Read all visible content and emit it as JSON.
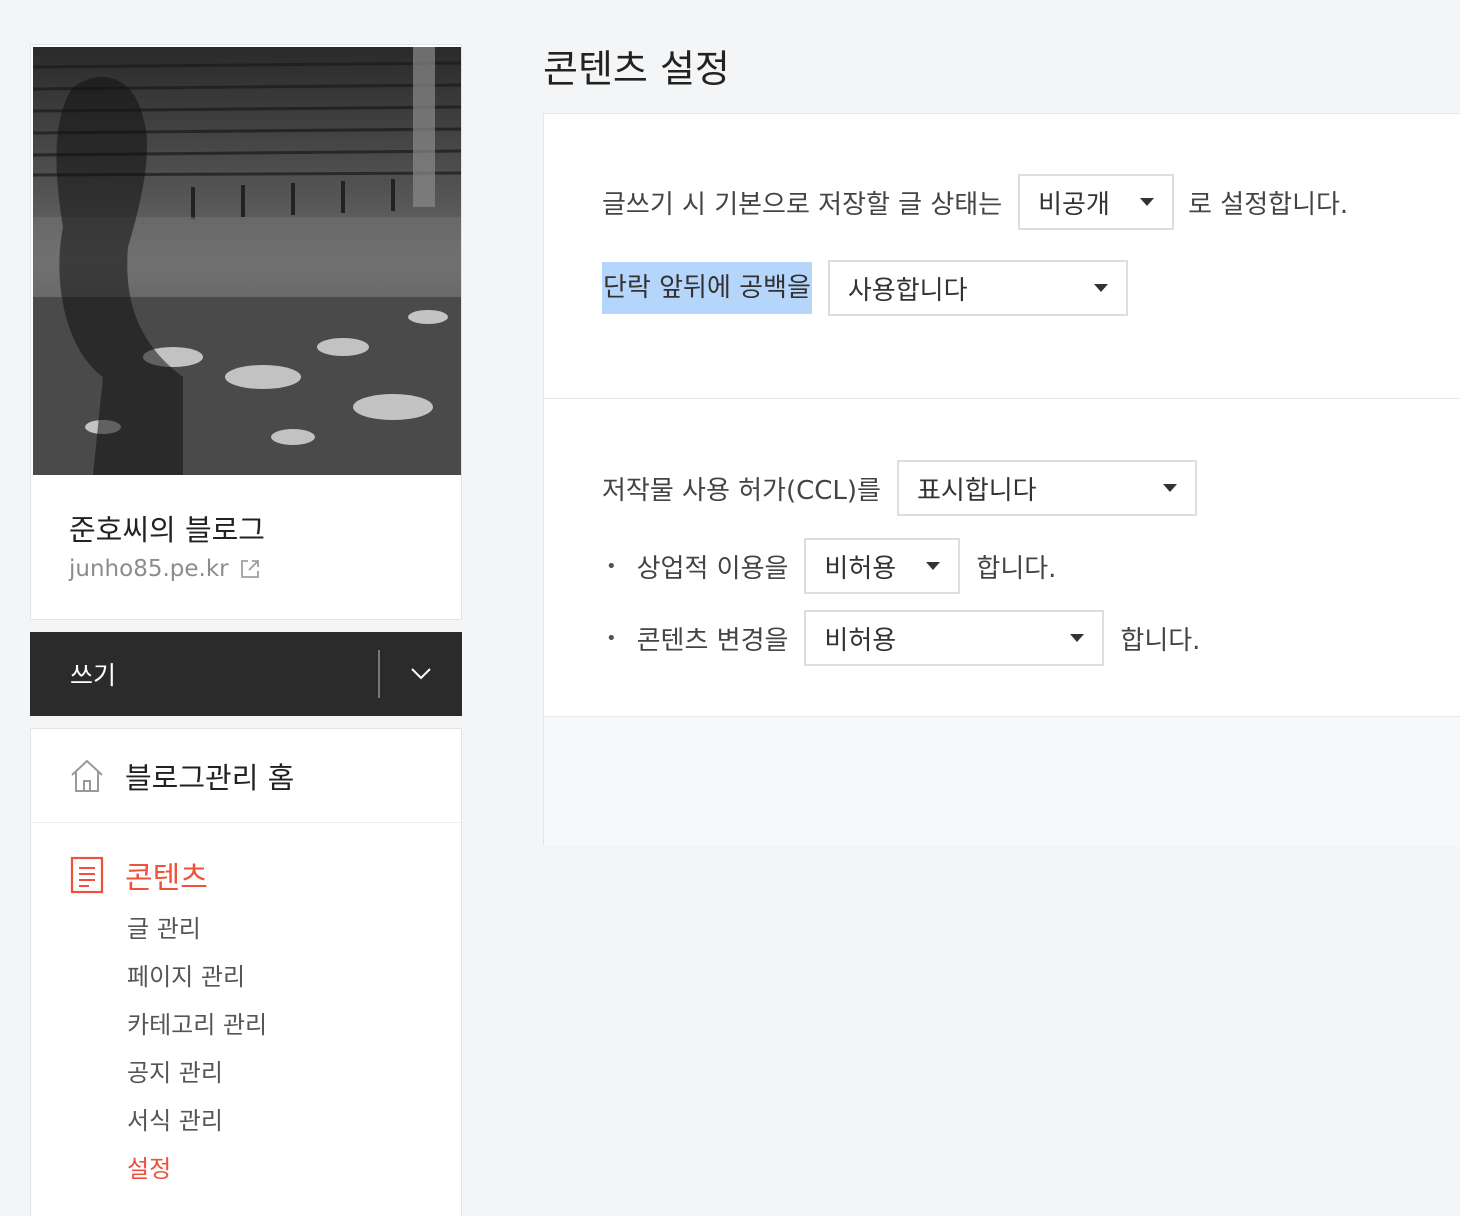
{
  "sidebar": {
    "blog_name": "준호씨의 블로그",
    "blog_url": "junho85.pe.kr",
    "write_label": "쓰기",
    "home_label": "블로그관리 홈",
    "section_label": "콘텐츠",
    "submenu": [
      "글 관리",
      "페이지 관리",
      "카테고리 관리",
      "공지 관리",
      "서식 관리",
      "설정"
    ],
    "accent_color": "#f0513a"
  },
  "main": {
    "title": "콘텐츠 설정",
    "row1": {
      "prefix": "글쓰기 시 기본으로 저장할 글 상태는",
      "value": "비공개",
      "suffix": "로 설정합니다."
    },
    "row2": {
      "prefix": "단락 앞뒤에 공백을",
      "value": "사용합니다"
    },
    "row3": {
      "prefix": "저작물 사용 허가(CCL)를",
      "value": "표시합니다"
    },
    "row4": {
      "bullet": "•",
      "prefix": "상업적 이용을",
      "value": "비허용",
      "suffix": "합니다."
    },
    "row5": {
      "bullet": "•",
      "prefix": "콘텐츠 변경을",
      "value": "비허용",
      "suffix": "합니다."
    }
  },
  "icons": [
    "external-link-icon",
    "chevron-down-icon",
    "home-icon",
    "document-icon",
    "dropdown-caret-icon"
  ]
}
